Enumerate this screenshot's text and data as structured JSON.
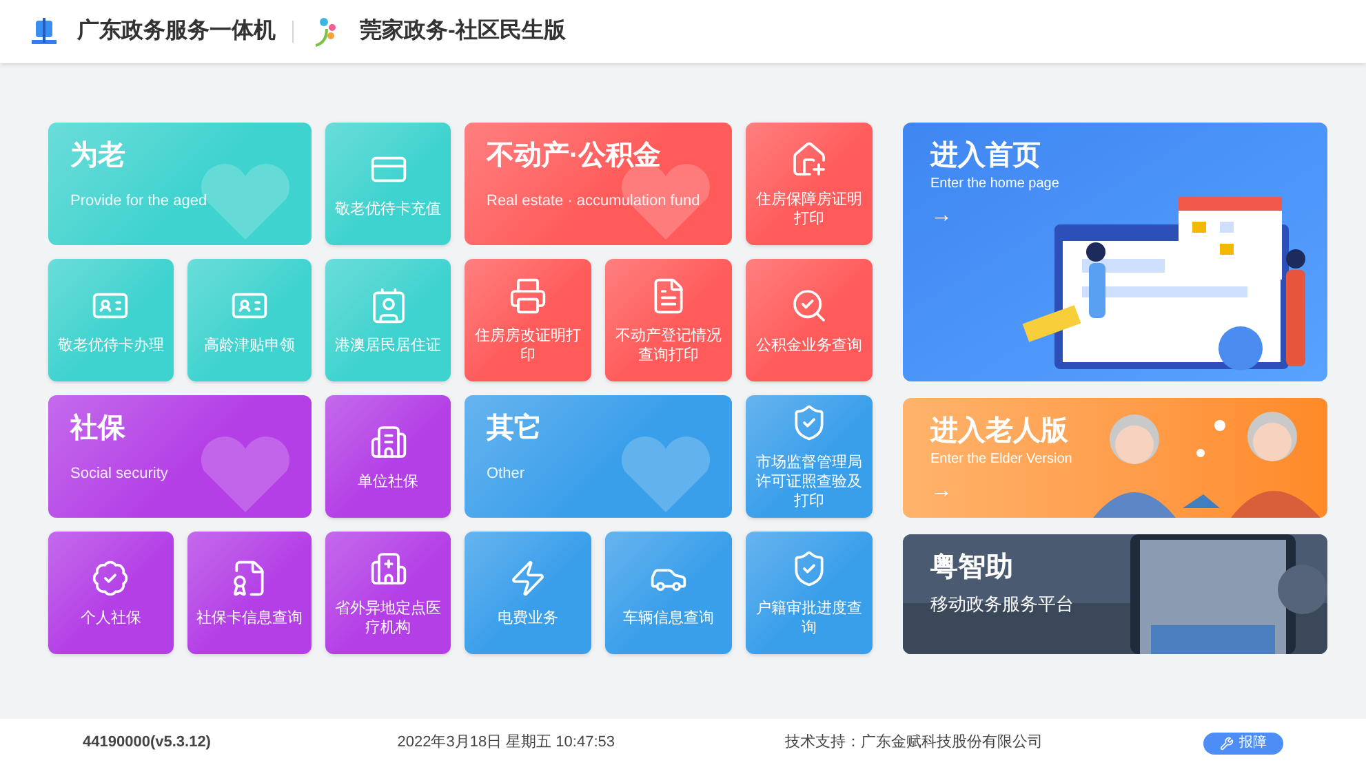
{
  "header": {
    "title": "广东政务服务一体机",
    "subtitle": "莞家政务-社区民生版"
  },
  "groups": [
    {
      "title": "为老",
      "subtitle": "Provide for the aged",
      "color": "#3fd3cf",
      "tiles": [
        "敬老优待卡充值",
        "敬老优待卡办理",
        "高龄津贴申领",
        "港澳居民居住证"
      ]
    },
    {
      "title": "不动产·公积金",
      "subtitle": "Real estate · accumulation fund",
      "color": "#ff5b5b",
      "tiles": [
        "住房保障房证明打印",
        "住房房改证明打印",
        "不动产登记情况查询打印",
        "公积金业务查询"
      ]
    },
    {
      "title": "社保",
      "subtitle": "Social security",
      "color": "#b43fe6",
      "tiles": [
        "单位社保",
        "个人社保",
        "社保卡信息查询",
        "省外异地定点医疗机构"
      ]
    },
    {
      "title": "其它",
      "subtitle": "Other",
      "color": "#3a9fea",
      "tiles": [
        "市场监督管理局许可证照查验及打印",
        "电费业务",
        "车辆信息查询",
        "户籍审批进度查询"
      ]
    }
  ],
  "side_cards": [
    {
      "kind": "home",
      "title": "进入首页",
      "subtitle": "Enter the home page",
      "arrow": "→"
    },
    {
      "kind": "elder",
      "title": "进入老人版",
      "subtitle": "Enter the Elder Version",
      "arrow": "→"
    },
    {
      "title": "粤智助",
      "subtitle": "移动政务服务平台"
    }
  ],
  "footer": {
    "device": "44190000(v5.3.12)",
    "datetime": "2022年3月18日 星期五 10:47:53",
    "support": "技术支持：广东金赋科技股份有限公司",
    "report_button": "报障"
  }
}
